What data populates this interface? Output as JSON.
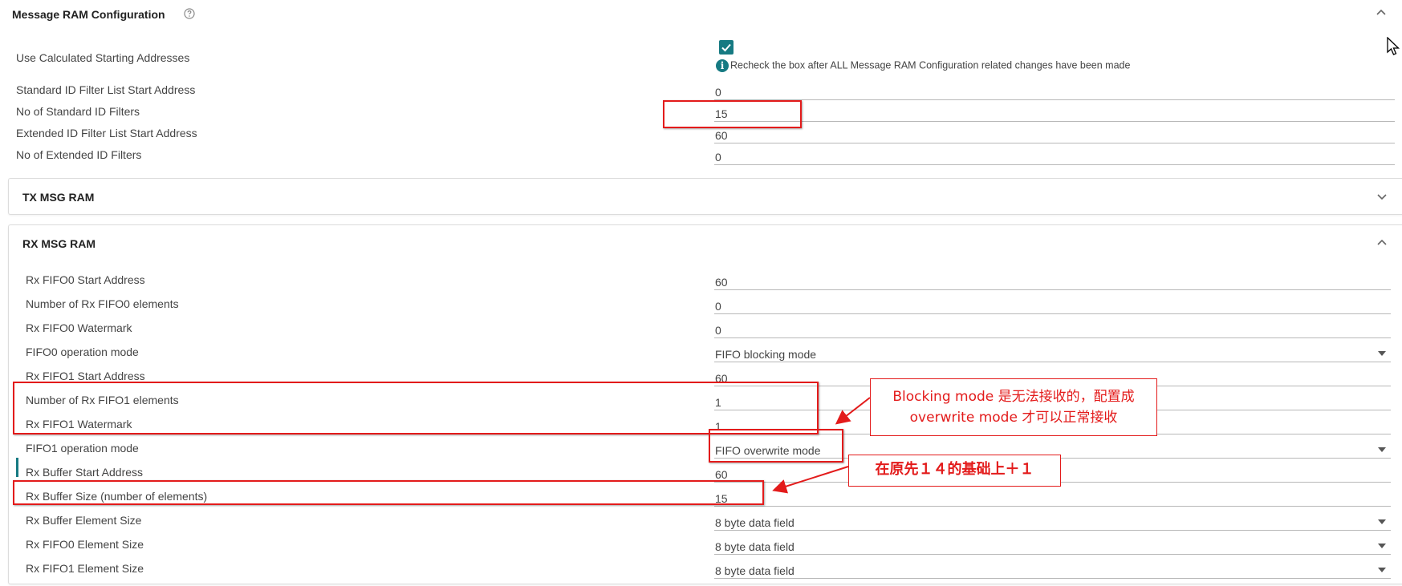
{
  "message_ram": {
    "title": "Message RAM Configuration",
    "use_calc_label": "Use Calculated Starting Addresses",
    "use_calc_checked": true,
    "info_text": "Recheck the box after ALL Message RAM Configuration related changes have been made",
    "fields": [
      {
        "label": "Standard ID Filter List Start Address",
        "value": "0"
      },
      {
        "label": "No of Standard ID Filters",
        "value": "15"
      },
      {
        "label": "Extended ID Filter List Start Address",
        "value": "60"
      },
      {
        "label": "No of Extended ID Filters",
        "value": "0"
      }
    ]
  },
  "tx_panel": {
    "title": "TX MSG RAM"
  },
  "rx_panel": {
    "title": "RX MSG RAM",
    "fields": [
      {
        "label": "Rx FIFO0 Start Address",
        "value": "60"
      },
      {
        "label": "Number of Rx FIFO0 elements",
        "value": "0"
      },
      {
        "label": "Rx FIFO0 Watermark",
        "value": "0"
      },
      {
        "label": "FIFO0 operation mode",
        "value": "FIFO blocking mode",
        "type": "select"
      },
      {
        "label": "Rx FIFO1 Start Address",
        "value": "60"
      },
      {
        "label": "Number of Rx FIFO1 elements",
        "value": "1"
      },
      {
        "label": "Rx FIFO1 Watermark",
        "value": "1"
      },
      {
        "label": "FIFO1 operation mode",
        "value": "FIFO overwrite mode",
        "type": "select"
      },
      {
        "label": "Rx Buffer Start Address",
        "value": "60"
      },
      {
        "label": "Rx Buffer Size (number of elements)",
        "value": "15"
      },
      {
        "label": "Rx Buffer Element Size",
        "value": "8 byte data field",
        "type": "select"
      },
      {
        "label": "Rx FIFO0 Element Size",
        "value": "8 byte data field",
        "type": "select"
      },
      {
        "label": "Rx FIFO1 Element Size",
        "value": "8 byte data field",
        "type": "select"
      }
    ]
  },
  "annotations": {
    "note_mode_line1": "Blocking mode 是无法接收的，配置成",
    "note_mode_line2": "overwrite  mode 才可以正常接收",
    "note_size": "在原先１４的基础上＋１"
  },
  "colors": {
    "accent": "#167a82",
    "annotation": "#e31b1b"
  },
  "icons": [
    "help-icon",
    "chevron-up-icon",
    "chevron-down-icon",
    "check-icon",
    "info-icon",
    "cursor-icon",
    "dropdown-arrow-icon"
  ]
}
